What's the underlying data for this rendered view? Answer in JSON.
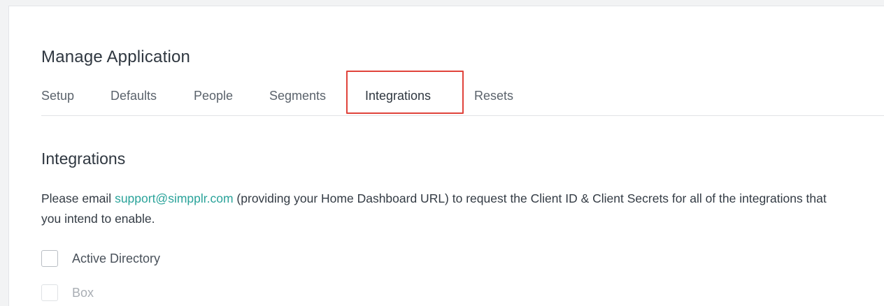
{
  "page": {
    "title": "Manage Application"
  },
  "tabs": [
    {
      "label": "Setup",
      "active": false
    },
    {
      "label": "Defaults",
      "active": false
    },
    {
      "label": "People",
      "active": false
    },
    {
      "label": "Segments",
      "active": false
    },
    {
      "label": "Integrations",
      "active": true
    },
    {
      "label": "Resets",
      "active": false
    }
  ],
  "section": {
    "title": "Integrations",
    "description_before": "Please email ",
    "support_email": "support@simpplr.com",
    "description_after": " (providing your Home Dashboard URL) to request the Client ID & Client Secrets for all of the integrations that you intend to enable."
  },
  "integrations": [
    {
      "label": "Active Directory",
      "checked": false
    },
    {
      "label": "Box",
      "checked": false
    }
  ],
  "colors": {
    "link": "#2aa39a",
    "highlight": "#e0433b"
  }
}
